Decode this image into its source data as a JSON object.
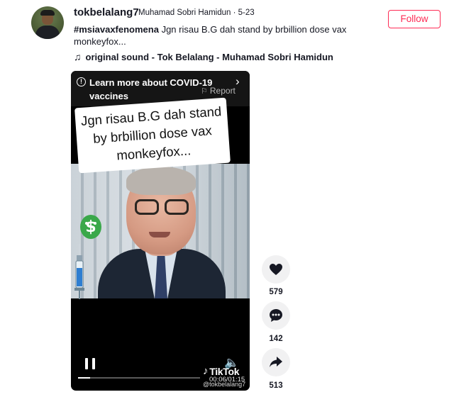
{
  "post": {
    "username": "tokbelalang7",
    "subline": "Muhamad Sobri Hamidun · 5-23",
    "hashtag": "#msiavaxfenomena",
    "caption_text": " Jgn risau B.G dah stand by brbillion dose vax monkeyfox...",
    "sound_label": "original sound - Tok Belalang - Muhamad Sobri Hamidun",
    "follow_label": "Follow"
  },
  "video": {
    "banner_text": "Learn more about COVID-19 vaccines",
    "report_label": "Report",
    "sticker_text": "Jgn risau B.G dah stand by brbillion dose vax monkeyfox...",
    "brand": "TikTok",
    "timecode": "00:06/01:15",
    "handle": "@tokbelalang7",
    "progress": 0.1
  },
  "actions": {
    "likes": "579",
    "comments": "142",
    "shares": "513"
  },
  "colors": {
    "accent": "#fe2c55",
    "text": "#161823",
    "action_bg": "#f1f1f2"
  },
  "icons": {
    "music": "music-note-icon",
    "info": "info-icon",
    "flag": "flag-icon",
    "like": "heart-icon",
    "comment": "comment-icon",
    "share": "share-icon"
  }
}
